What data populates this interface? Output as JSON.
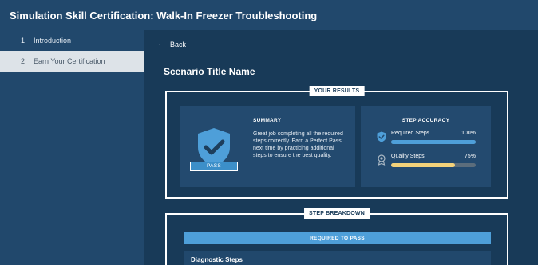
{
  "header": {
    "title": "Simulation Skill Certification: Walk-In Freezer Troubleshooting"
  },
  "sidebar": {
    "items": [
      {
        "number": "1",
        "label": "Introduction",
        "active": false
      },
      {
        "number": "2",
        "label": "Earn Your Certification",
        "active": true
      }
    ]
  },
  "main": {
    "back_label": "Back",
    "scenario_title": "Scenario Title Name",
    "results": {
      "label": "YOUR RESULTS",
      "summary": {
        "heading": "SUMMARY",
        "text": "Great job completing all the required steps correctly. Earn a Perfect Pass next time by practicing additional steps to ensure the best quality.",
        "badge": "PASS",
        "icon": "shield-check-icon"
      },
      "accuracy": {
        "heading": "STEP ACCURACY",
        "rows": [
          {
            "label": "Required Steps",
            "value": "100%",
            "fraction": 1.0,
            "color": "#4e9fd9",
            "icon": "shield-check-icon"
          },
          {
            "label": "Quality Steps",
            "value": "75%",
            "fraction": 0.75,
            "color": "#f3d27a",
            "icon": "ribbon-icon"
          }
        ]
      }
    },
    "breakdown": {
      "label": "STEP BREAKDOWN",
      "banner": "REQUIRED TO PASS",
      "first_row": "Diagnostic Steps"
    }
  },
  "colors": {
    "background": "#1d3e5c",
    "panel": "#21486c",
    "accent": "#4e9fd9",
    "quality": "#f3d27a"
  }
}
